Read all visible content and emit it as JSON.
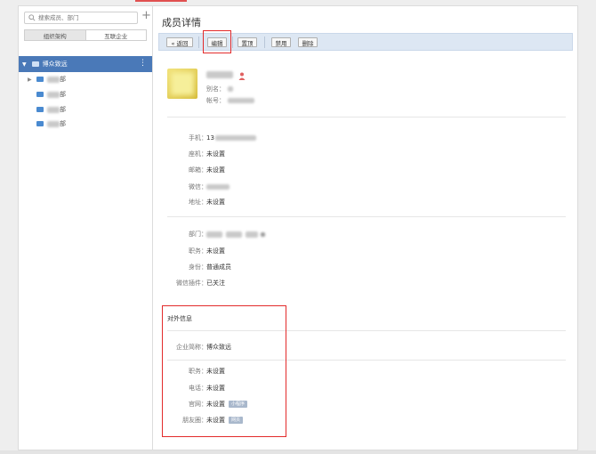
{
  "sidebar": {
    "search_placeholder": "搜索成员、部门",
    "add_label": "+",
    "tabs": {
      "org": "组织架构",
      "partner": "互联企业"
    },
    "root_label": "博众致远",
    "child_suffix": "部",
    "more_label": "⋮"
  },
  "main": {
    "title": "成员详情",
    "toolbar": {
      "back": "« 返回",
      "edit": "编辑",
      "top": "置顶",
      "disable": "禁用",
      "delete": "删除"
    },
    "profile": {
      "alias_label": "别名：",
      "account_label": "帐号："
    },
    "contact": {
      "mobile_label": "手机：",
      "mobile_value_prefix": "13",
      "ext_label": "座机：",
      "ext_value": "未设置",
      "email_label": "邮箱：",
      "email_value": "未设置",
      "wechat_label": "微信：",
      "address_label": "地址：",
      "address_value": "未设置"
    },
    "org": {
      "dept_label": "部门：",
      "position_label": "职务：",
      "position_value": "未设置",
      "identity_label": "身份：",
      "identity_value": "普通成员",
      "plugin_label": "微信插件：",
      "plugin_value": "已关注"
    },
    "external": {
      "section_title": "对外信息",
      "company_label": "企业简称：",
      "company_value": "博众致远",
      "position_label": "职务：",
      "position_value": "未设置",
      "phone_label": "电话：",
      "phone_value": "未设置",
      "website_label": "官网：",
      "website_value": "未设置",
      "website_tag": "小程序",
      "moments_label": "朋友圈：",
      "moments_value": "未设置",
      "moments_tag": "网页"
    }
  },
  "colors": {
    "accent_blue": "#4a79b8",
    "highlight_red": "#e32b2b",
    "toolbar_bg": "#dde7f3"
  }
}
